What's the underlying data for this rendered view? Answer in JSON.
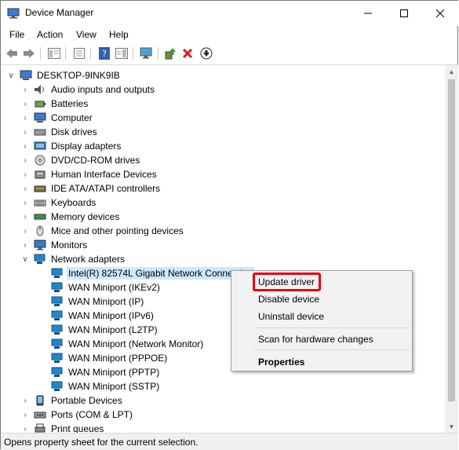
{
  "window": {
    "title": "Device Manager"
  },
  "menu": [
    "File",
    "Action",
    "View",
    "Help"
  ],
  "tree": {
    "root": "DESKTOP-9INK9IB",
    "categories": [
      "Audio inputs and outputs",
      "Batteries",
      "Computer",
      "Disk drives",
      "Display adapters",
      "DVD/CD-ROM drives",
      "Human Interface Devices",
      "IDE ATA/ATAPI controllers",
      "Keyboards",
      "Memory devices",
      "Mice and other pointing devices",
      "Monitors"
    ],
    "network": {
      "label": "Network adapters",
      "children": [
        "Intel(R) 82574L Gigabit Network Connection",
        "WAN Miniport (IKEv2)",
        "WAN Miniport (IP)",
        "WAN Miniport (IPv6)",
        "WAN Miniport (L2TP)",
        "WAN Miniport (Network Monitor)",
        "WAN Miniport (PPPOE)",
        "WAN Miniport (PPTP)",
        "WAN Miniport (SSTP)"
      ]
    },
    "after": [
      "Portable Devices",
      "Ports (COM & LPT)",
      "Print queues"
    ]
  },
  "context_menu": {
    "update": "Update driver",
    "disable": "Disable device",
    "uninstall": "Uninstall device",
    "scan": "Scan for hardware changes",
    "properties": "Properties"
  },
  "status": "Opens property sheet for the current selection.",
  "colors": {
    "highlight": "#e8000c",
    "selection": "#cce8ff",
    "network_icon": "#1e88c8"
  }
}
